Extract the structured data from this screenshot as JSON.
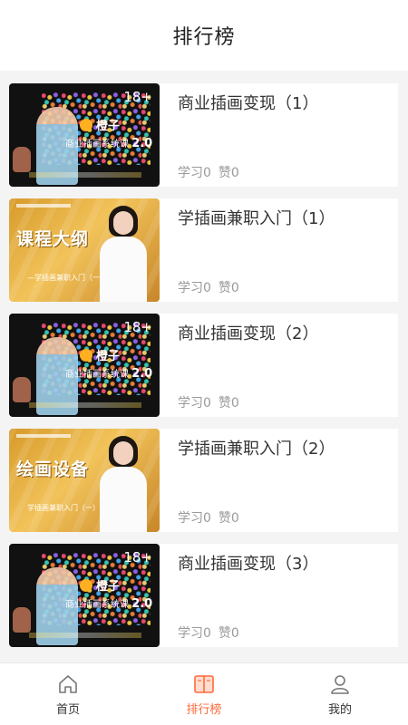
{
  "header": {
    "title": "排行榜"
  },
  "thumbnails": {
    "dark": {
      "badge": "18+",
      "brand": "橙子",
      "course_prefix": "商业插画系统课",
      "course_version": "2.0"
    },
    "gold1": {
      "big": "课程大纲",
      "sub": "—学插画兼职入门（一）"
    },
    "gold2": {
      "big": "绘画设备",
      "sub": "学插画兼职入门（一）"
    }
  },
  "items": [
    {
      "title": "商业插画变现（1）",
      "study": "学习0",
      "likes": "赞0"
    },
    {
      "title": "学插画兼职入门（1）",
      "study": "学习0",
      "likes": "赞0"
    },
    {
      "title": "商业插画变现（2）",
      "study": "学习0",
      "likes": "赞0"
    },
    {
      "title": "学插画兼职入门（2）",
      "study": "学习0",
      "likes": "赞0"
    },
    {
      "title": "商业插画变现（3）",
      "study": "学习0",
      "likes": "赞0"
    }
  ],
  "tabbar": {
    "tabs": [
      {
        "label": "首页",
        "icon": "home-icon"
      },
      {
        "label": "排行榜",
        "icon": "book-icon"
      },
      {
        "label": "我的",
        "icon": "user-icon"
      }
    ],
    "active_color": "#ff6a3d"
  }
}
